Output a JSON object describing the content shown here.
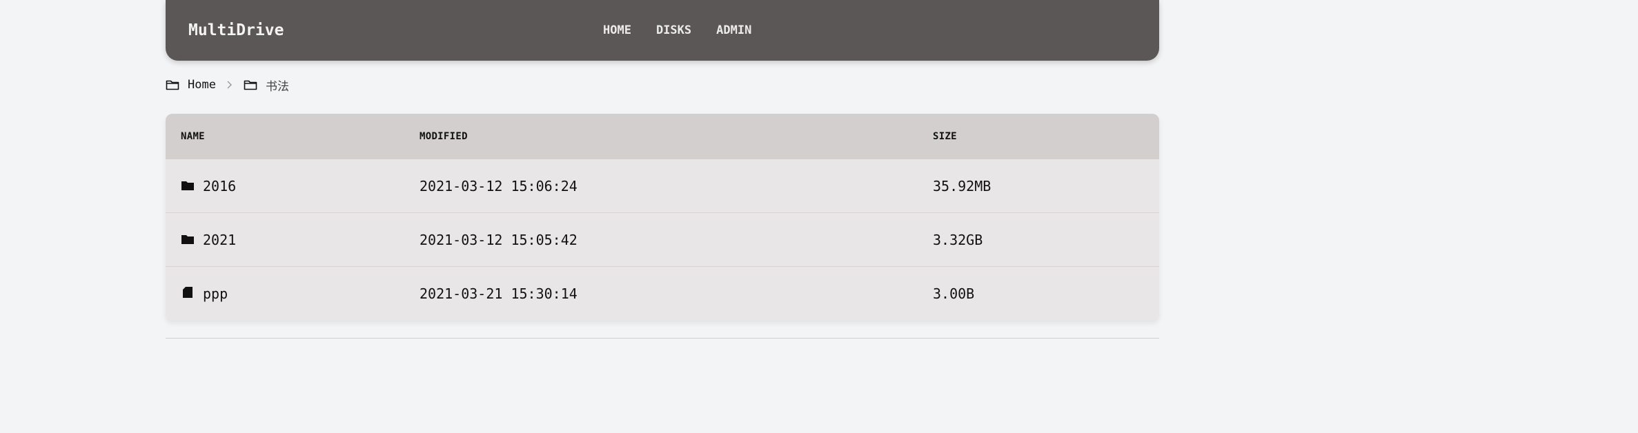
{
  "navbar": {
    "brand": "MultiDrive",
    "links": [
      "HOME",
      "DISKS",
      "ADMIN"
    ]
  },
  "breadcrumb": {
    "items": [
      {
        "label": "Home",
        "icon": "folder-outline-icon"
      },
      {
        "label": "书法",
        "icon": "folder-outline-icon"
      }
    ],
    "separator_icon": "chevron-right-icon"
  },
  "table": {
    "headers": {
      "name": "NAME",
      "modified": "MODIFIED",
      "size": "SIZE"
    },
    "rows": [
      {
        "name": "2016",
        "modified": "2021-03-12 15:06:24",
        "size": "35.92MB",
        "icon": "folder-icon"
      },
      {
        "name": "2021",
        "modified": "2021-03-12 15:05:42",
        "size": "3.32GB",
        "icon": "folder-icon"
      },
      {
        "name": "ppp",
        "modified": "2021-03-21 15:30:14",
        "size": "3.00B",
        "icon": "file-icon"
      }
    ]
  },
  "colors": {
    "navbar_bg": "#5c5757",
    "page_bg": "#f3f4f6",
    "table_header_bg": "#d2cfce",
    "table_row_bg": "#e8e6e6"
  }
}
